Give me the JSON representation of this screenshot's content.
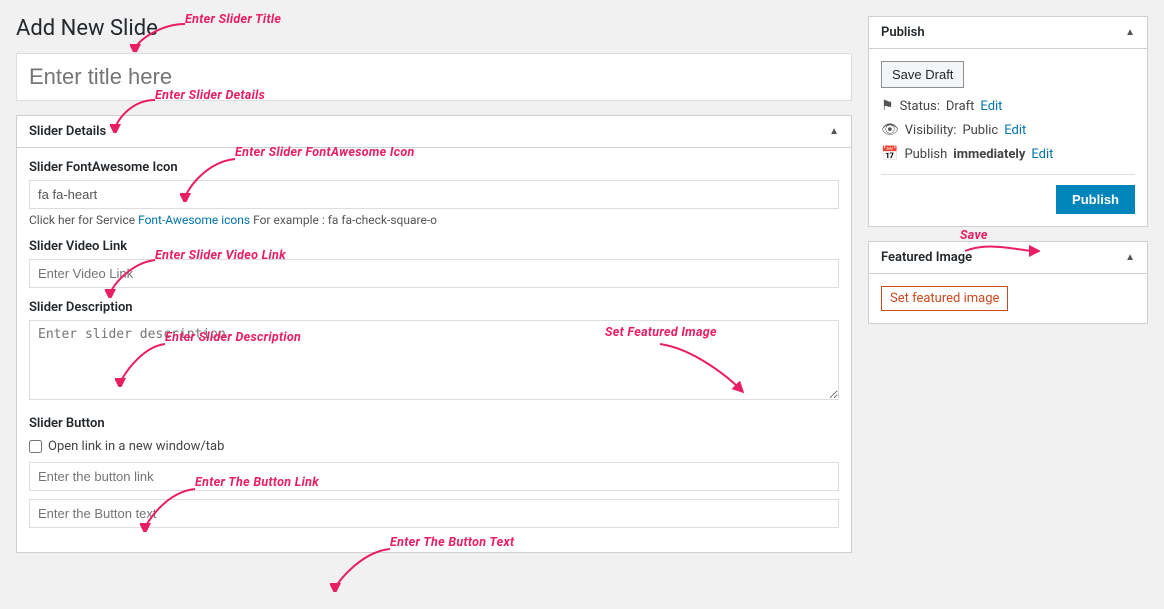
{
  "page": {
    "title": "Add New Slide"
  },
  "annotations": {
    "enter_slider_title": "Enter Slider Title",
    "enter_slider_details": "Enter Slider Details",
    "enter_fontawesome_icon": "Enter Slider FontAwesome Icon",
    "enter_video_link": "Enter Slider Video Link",
    "enter_description": "Enter Slider Description",
    "enter_button_link": "Enter The Button Link",
    "enter_button_text": "Enter The Button Text",
    "save": "Save",
    "set_featured_image": "Set Featured Image"
  },
  "title_input": {
    "placeholder": "Enter title here"
  },
  "slider_details": {
    "section_title": "Slider Details",
    "icon_label": "Slider FontAwesome Icon",
    "icon_value": "fa fa-heart",
    "icon_hint_prefix": "Click her for Service ",
    "icon_hint_link_text": "Font-Awesome icons",
    "icon_hint_suffix": " For example : fa fa-check-square-o",
    "video_label": "Slider Video Link",
    "video_placeholder": "Enter Video Link",
    "description_label": "Slider Description",
    "description_placeholder": "Enter slider description",
    "button_section": "Slider Button",
    "checkbox_label": "Open link in a new window/tab",
    "button_link_placeholder": "Enter the button link",
    "button_text_placeholder": "Enter the Button text"
  },
  "publish_box": {
    "title": "Publish",
    "save_draft_label": "Save Draft",
    "status_label": "Status:",
    "status_value": "Draft",
    "status_edit": "Edit",
    "visibility_label": "Visibility:",
    "visibility_value": "Public",
    "visibility_edit": "Edit",
    "publish_time_label": "Publish",
    "publish_time_value": "immediately",
    "publish_time_edit": "Edit",
    "publish_btn_label": "Publish"
  },
  "featured_image_box": {
    "title": "Featured Image",
    "set_link_label": "Set featured image"
  },
  "icons": {
    "collapse_up": "▲",
    "status_icon": "⚑",
    "visibility_icon": "👁",
    "calendar_icon": "📅"
  }
}
